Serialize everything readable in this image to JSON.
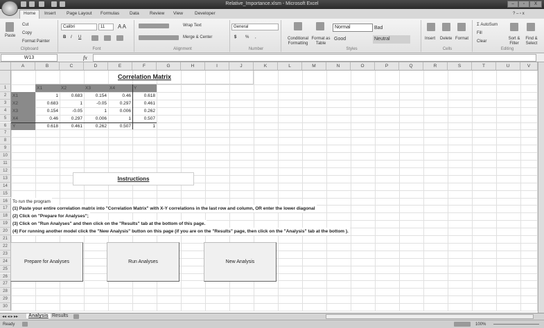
{
  "window": {
    "title": "Relative_Importance.xlsm - Microsoft Excel",
    "min": "–",
    "max": "▫",
    "close": "X"
  },
  "ribbon_tabs": [
    "Home",
    "Insert",
    "Page Layout",
    "Formulas",
    "Data",
    "Review",
    "View",
    "Developer"
  ],
  "clipboard": {
    "paste": "Paste",
    "cut": "Cut",
    "copy": "Copy",
    "format_painter": "Format Painter",
    "label": "Clipboard"
  },
  "font": {
    "name": "Calibri",
    "size": "11",
    "bold": "B",
    "italic": "I",
    "underline": "U",
    "label": "Font"
  },
  "alignment": {
    "wrap": "Wrap Text",
    "merge": "Merge & Center",
    "label": "Alignment"
  },
  "number": {
    "format": "General",
    "currency": "$",
    "percent": "%",
    "comma": ",",
    "label": "Number"
  },
  "styles": {
    "conditional": "Conditional Formatting",
    "format_table": "Format as Table",
    "normal": "Normal",
    "bad": "Bad",
    "good": "Good",
    "neutral": "Neutral",
    "label": "Styles"
  },
  "cells": {
    "insert": "Insert",
    "delete": "Delete",
    "format": "Format",
    "label": "Cells"
  },
  "editing": {
    "autosum": "AutoSum",
    "fill": "Fill",
    "clear": "Clear",
    "sort": "Sort & Filter",
    "find": "Find & Select",
    "label": "Editing"
  },
  "formula_bar": {
    "name_box": "W13",
    "fx": "fx",
    "value": ""
  },
  "columns": [
    "A",
    "B",
    "C",
    "D",
    "E",
    "F",
    "G",
    "H",
    "I",
    "J",
    "K",
    "L",
    "M",
    "N",
    "O",
    "P",
    "Q",
    "R",
    "S",
    "T",
    "U",
    "V"
  ],
  "matrix": {
    "title": "Correlation Matrix",
    "headers": [
      "X1",
      "X2",
      "X3",
      "X4",
      "Y"
    ],
    "rows": [
      {
        "label": "X1",
        "values": [
          "1",
          "0.683",
          "0.154",
          "0.46",
          "0.618"
        ]
      },
      {
        "label": "X2",
        "values": [
          "0.683",
          "1",
          "-0.05",
          "0.297",
          "0.461"
        ]
      },
      {
        "label": "X3",
        "values": [
          "0.154",
          "-0.05",
          "1",
          "0.006",
          "0.262"
        ]
      },
      {
        "label": "X4",
        "values": [
          "0.46",
          "0.297",
          "0.006",
          "1",
          "0.507"
        ]
      },
      {
        "label": "Y",
        "values": [
          "0.618",
          "0.461",
          "0.262",
          "0.507",
          "1"
        ]
      }
    ]
  },
  "instructions": {
    "title": "Instructions",
    "lines": [
      {
        "row": 16,
        "text": "To run the program"
      },
      {
        "row": 17,
        "text": "(1) Paste your entire correlation matrix into \"Correlation Matrix\" with X-Y correlations in the last row and column, OR enter the lower diagonal"
      },
      {
        "row": 18,
        "text": "(2) Click on \"Prepare for Analyses\";"
      },
      {
        "row": 19,
        "text": "(3) Click on \"Run Analyses\" and then click on the \"Results\" tab at the bottom of this page."
      },
      {
        "row": 20,
        "text": "(4) For running another model click the \"New Analysis\" button on this page (if you are on the \"Results\" page, then click on the \"Analysis\" tab at the bottom )."
      }
    ]
  },
  "buttons": {
    "prepare": "Prepare for Analyses",
    "run": "Run Analyses",
    "new": "New Analysis"
  },
  "sheets": [
    {
      "name": "Analysis",
      "active": true
    },
    {
      "name": "Results",
      "active": false
    }
  ],
  "status": {
    "ready": "Ready",
    "zoom": "100%"
  }
}
